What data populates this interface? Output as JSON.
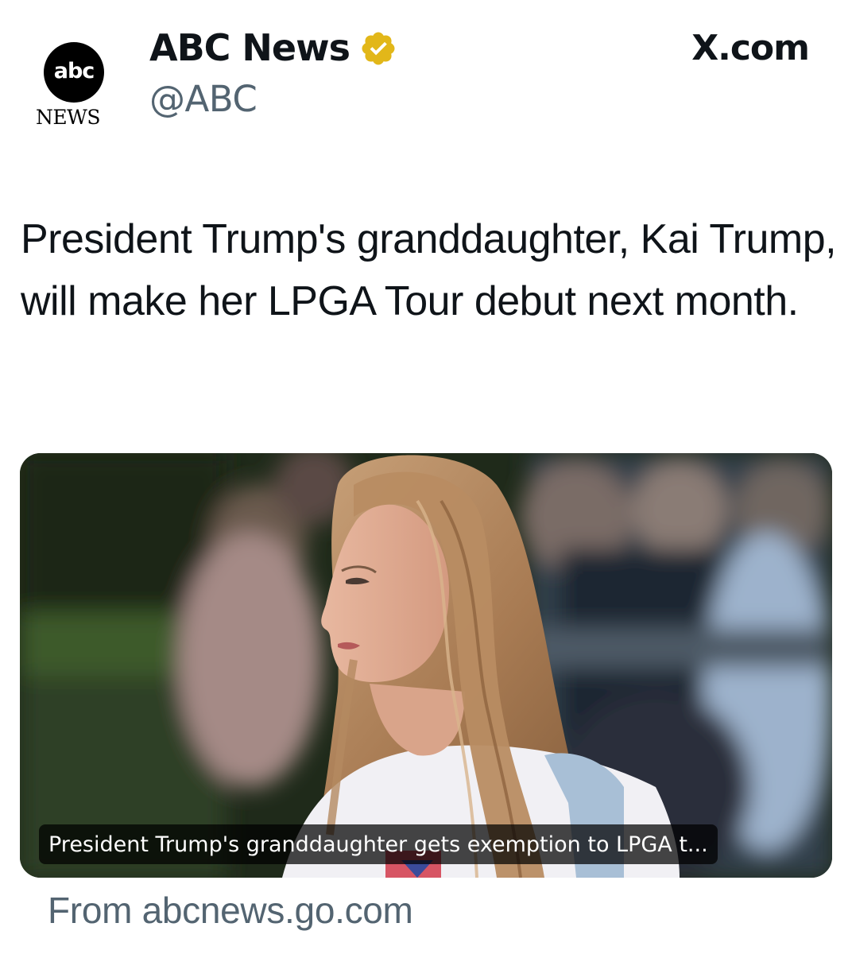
{
  "header": {
    "avatar": {
      "logo_text": "abc",
      "sub_text": "NEWS"
    },
    "display_name": "ABC News",
    "verified_badge_icon": "verified-badge-icon",
    "verified_badge_color": "#e2b719",
    "handle": "@ABC",
    "site_label": "X.com"
  },
  "tweet": {
    "text": "President Trump's granddaughter, Kai Trump, will make her LPGA Tour debut next month."
  },
  "card": {
    "image_description_icon": "photo",
    "caption": "President Trump's granddaughter gets exemption to LPGA t..."
  },
  "source": {
    "label": "From abcnews.go.com"
  },
  "colors": {
    "text_primary": "#0f1419",
    "text_secondary": "#536471",
    "background": "#ffffff"
  }
}
